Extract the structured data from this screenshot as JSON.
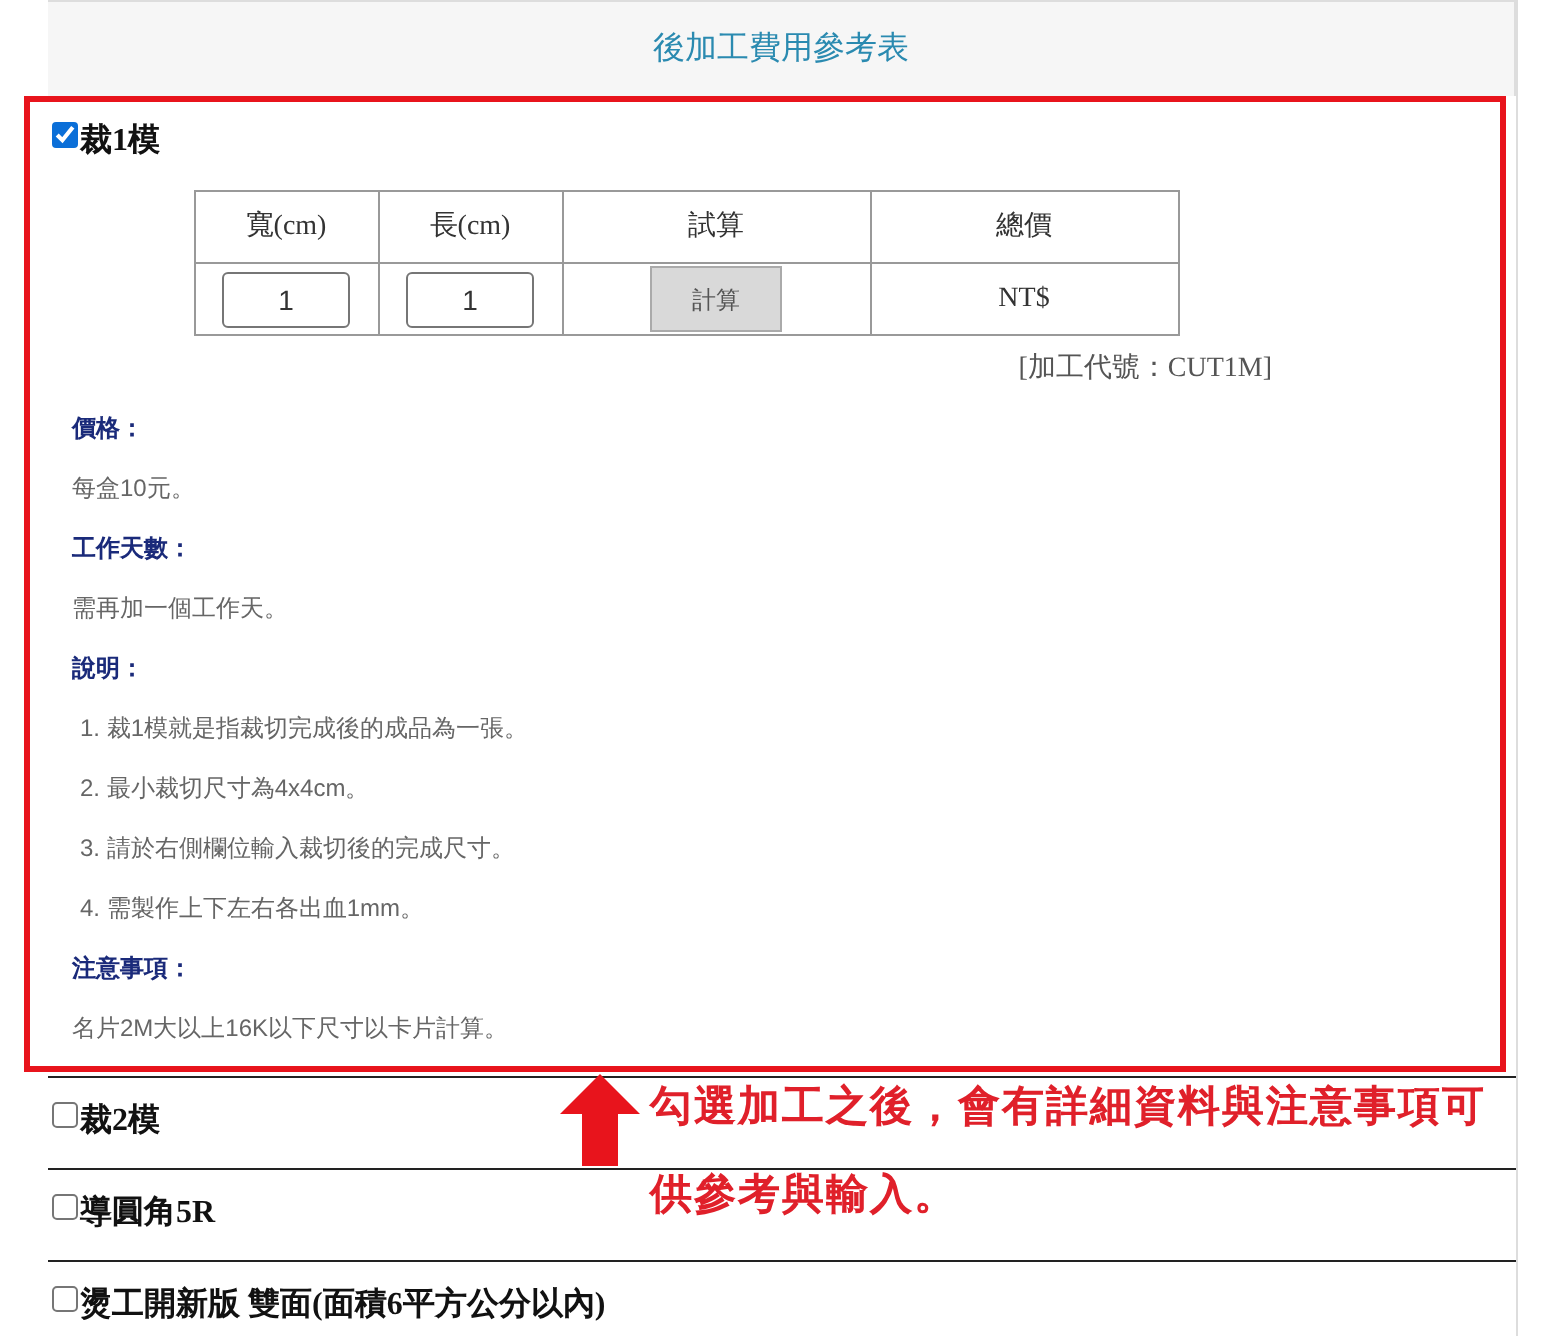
{
  "title": "後加工費用參考表",
  "options": [
    {
      "label": "裁1模",
      "checked": true,
      "detail": {
        "table": {
          "columns": [
            "寬(cm)",
            "長(cm)",
            "試算",
            "總價"
          ],
          "width_value": "1",
          "length_value": "1",
          "calc_button": "計算",
          "total": "NT$"
        },
        "code": "[加工代號：CUT1M]",
        "sections": [
          {
            "kind": "heading",
            "text": "價格："
          },
          {
            "kind": "text",
            "text": "每盒10元。"
          },
          {
            "kind": "heading",
            "text": "工作天數："
          },
          {
            "kind": "text",
            "text": "需再加一個工作天。"
          },
          {
            "kind": "heading",
            "text": "說明："
          },
          {
            "kind": "item",
            "text": "1. 裁1模就是指裁切完成後的成品為一張。"
          },
          {
            "kind": "item",
            "text": "2. 最小裁切尺寸為4x4cm。"
          },
          {
            "kind": "item",
            "text": "3. 請於右側欄位輸入裁切後的完成尺寸。"
          },
          {
            "kind": "item",
            "text": "4. 需製作上下左右各出血1mm。"
          },
          {
            "kind": "heading",
            "text": "注意事項："
          },
          {
            "kind": "text",
            "text": "名片2M大以上16K以下尺寸以卡片計算。"
          }
        ]
      }
    },
    {
      "label": "裁2模",
      "checked": false
    },
    {
      "label": "導圓角5R",
      "checked": false
    },
    {
      "label": "燙工開新版 雙面(面積6平方公分以內)",
      "checked": false
    }
  ],
  "annotation": "勾選加工之後，會有詳細資料與注意事項可供參考與輸入。"
}
